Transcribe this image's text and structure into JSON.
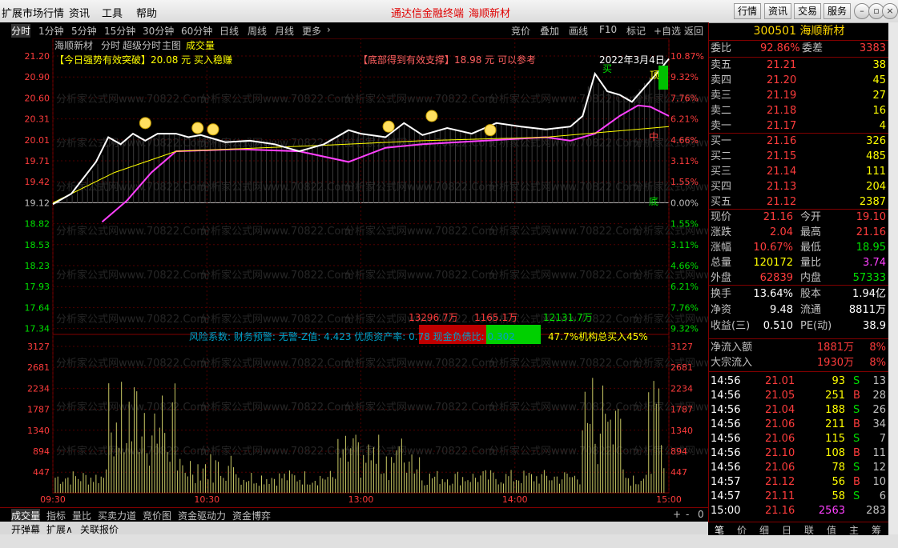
{
  "menubar": {
    "items": [
      "扩展市场行情",
      "资讯",
      "工具",
      "帮助"
    ],
    "title": "通达信金融终端",
    "stock_name": "海顺新材",
    "buttons": [
      "行情",
      "资讯",
      "交易",
      "服务"
    ]
  },
  "tabs": [
    "分时",
    "1分钟",
    "5分钟",
    "15分钟",
    "30分钟",
    "60分钟",
    "日线",
    "周线",
    "月线",
    "更多"
  ],
  "right_tools": [
    "竞价",
    "叠加",
    "画线",
    "F10",
    "标记",
    "+自选",
    "返回"
  ],
  "chart": {
    "caption": {
      "name": "海顺新材",
      "mode": "分时",
      "super": "超级分时",
      "main": "主图",
      "vol": "成交量"
    },
    "signal_left": "【今日强势有效突破】20.08 元 买入稳赚",
    "signal_right": "【底部得到有效支撑】18.98 元 可以参考",
    "date": "2022年3月4日",
    "marker_buy": "买",
    "marker_top": "顶",
    "marker_mid": "中",
    "marker_bottom": "底",
    "price_ticks": [
      "21.20",
      "20.90",
      "20.60",
      "20.31",
      "20.01",
      "19.71",
      "19.42",
      "19.12",
      "18.82",
      "18.53",
      "18.23",
      "17.93",
      "17.64",
      "17.34"
    ],
    "pct_ticks": [
      "10.87%",
      "9.32%",
      "7.76%",
      "6.21%",
      "4.66%",
      "3.11%",
      "1.55%",
      "0.00%",
      "1.55%",
      "3.11%",
      "4.66%",
      "6.21%",
      "7.76%",
      "9.32%"
    ],
    "vol_ticks": [
      "3127",
      "2681",
      "2234",
      "1787",
      "1340",
      "894",
      "447"
    ],
    "time_ticks": [
      "09:30",
      "10:30",
      "13:00",
      "14:00",
      "15:00"
    ],
    "flow": {
      "left": "13296.7万",
      "mid": "1165.1万",
      "right": "12131.7万"
    },
    "risk_text": "风险系数: 财务预警: 无警-Z值: 4.423 优质资产率: 0.78 现金负债比: 0.302",
    "inst_text": "47.7%机构总买入45%",
    "watermark": "分析家公式网www.70822.Com",
    "colors": {
      "up": "#ff3c3c",
      "down": "#00e000",
      "price_line": "#ffffff",
      "avg_line": "#ffff00",
      "ma_line": "#ff40ff",
      "volume": "#c8c864"
    }
  },
  "bottom_tabs": [
    "成交量",
    "指标",
    "量比",
    "买卖力道",
    "竞价图",
    "资金驱动力",
    "资金博弈"
  ],
  "status": [
    "开弹幕",
    "扩展∧",
    "关联报价"
  ],
  "panel": {
    "code": "300501",
    "name": "海顺新材",
    "weibi_label": "委比",
    "weibi": "92.86%",
    "weicha_label": "委差",
    "weicha": "3383",
    "asks": [
      {
        "l": "卖五",
        "p": "21.21",
        "v": "38"
      },
      {
        "l": "卖四",
        "p": "21.20",
        "v": "45"
      },
      {
        "l": "卖三",
        "p": "21.19",
        "v": "27"
      },
      {
        "l": "卖二",
        "p": "21.18",
        "v": "16"
      },
      {
        "l": "卖一",
        "p": "21.17",
        "v": "4"
      }
    ],
    "bids": [
      {
        "l": "买一",
        "p": "21.16",
        "v": "326"
      },
      {
        "l": "买二",
        "p": "21.15",
        "v": "485"
      },
      {
        "l": "买三",
        "p": "21.14",
        "v": "111"
      },
      {
        "l": "买四",
        "p": "21.13",
        "v": "204"
      },
      {
        "l": "买五",
        "p": "21.12",
        "v": "2387"
      }
    ],
    "quote": [
      {
        "a": "现价",
        "av": "21.16",
        "b": "今开",
        "bv": "19.10"
      },
      {
        "a": "涨跌",
        "av": "2.04",
        "b": "最高",
        "bv": "21.16"
      },
      {
        "a": "涨幅",
        "av": "10.67%",
        "b": "最低",
        "bv": "18.95"
      },
      {
        "a": "总量",
        "av": "120172",
        "b": "量比",
        "bv": "3.74"
      },
      {
        "a": "外盘",
        "av": "62839",
        "b": "内盘",
        "bv": "57333"
      }
    ],
    "fund": [
      {
        "a": "换手",
        "av": "13.64%",
        "b": "股本",
        "bv": "1.94亿"
      },
      {
        "a": "净资",
        "av": "9.48",
        "b": "流通",
        "bv": "8811万"
      },
      {
        "a": "收益(三)",
        "av": "0.510",
        "b": "PE(动)",
        "bv": "38.9"
      }
    ],
    "flows": [
      {
        "l": "净流入额",
        "v": "1881万",
        "p": "8%"
      },
      {
        "l": "大宗流入",
        "v": "1930万",
        "p": "8%"
      }
    ],
    "ticks": [
      {
        "t": "14:56",
        "p": "21.01",
        "v": "93",
        "s": "S",
        "n": "13"
      },
      {
        "t": "14:56",
        "p": "21.05",
        "v": "251",
        "s": "B",
        "n": "28"
      },
      {
        "t": "14:56",
        "p": "21.04",
        "v": "188",
        "s": "S",
        "n": "26"
      },
      {
        "t": "14:56",
        "p": "21.06",
        "v": "211",
        "s": "B",
        "n": "34"
      },
      {
        "t": "14:56",
        "p": "21.06",
        "v": "115",
        "s": "S",
        "n": "7"
      },
      {
        "t": "14:56",
        "p": "21.10",
        "v": "108",
        "s": "B",
        "n": "11"
      },
      {
        "t": "14:56",
        "p": "21.06",
        "v": "78",
        "s": "S",
        "n": "12"
      },
      {
        "t": "14:57",
        "p": "21.12",
        "v": "56",
        "s": "B",
        "n": "10"
      },
      {
        "t": "14:57",
        "p": "21.11",
        "v": "58",
        "s": "S",
        "n": "6"
      },
      {
        "t": "15:00",
        "p": "21.16",
        "v": "2563",
        "s": "",
        "n": "283"
      }
    ],
    "tabs": [
      "笔",
      "价",
      "细",
      "日",
      "联",
      "值",
      "主",
      "筹"
    ]
  }
}
